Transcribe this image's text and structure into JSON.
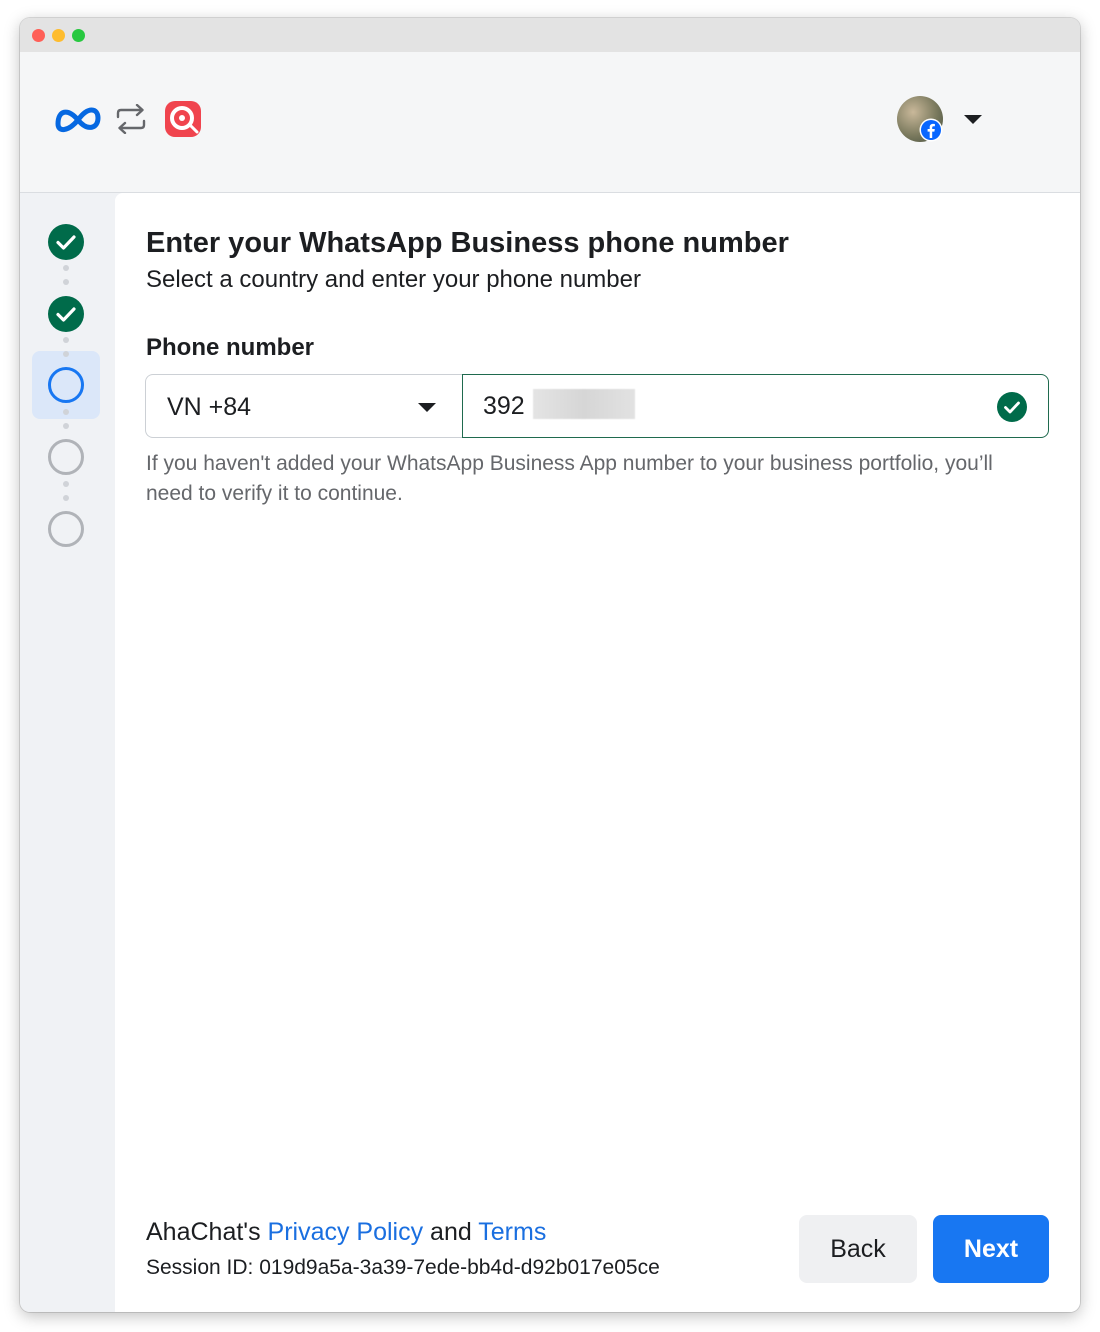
{
  "header": {
    "brand_icon": "meta-logo-icon",
    "connect_icon": "swap-arrows-icon",
    "app_icon": "ahachat-logo-icon",
    "account_badge_icon": "facebook-icon"
  },
  "stepper": {
    "steps": [
      {
        "state": "done"
      },
      {
        "state": "done"
      },
      {
        "state": "current"
      },
      {
        "state": "pending"
      },
      {
        "state": "pending"
      }
    ],
    "colors": {
      "done": "#006b4a",
      "current": "#1877f2",
      "pending": "#b0b3b8"
    }
  },
  "main": {
    "title": "Enter your WhatsApp Business phone number",
    "subtitle": "Select a country and enter your phone number",
    "phone_label": "Phone number",
    "country_value": "VN +84",
    "phone_value": "392",
    "helper_text": "If you haven't added your WhatsApp Business App number to your business portfolio, you’ll need to verify it to continue."
  },
  "footer": {
    "company_prefix": "AhaChat's ",
    "privacy_link": "Privacy Policy",
    "and_text": " and ",
    "terms_link": "Terms",
    "session_label": "Session ID: ",
    "session_id": "019d9a5a-3a39-7ede-bb4d-d92b017e05ce",
    "back_label": "Back",
    "next_label": "Next"
  },
  "colors": {
    "primary": "#1877f2",
    "success": "#006b4a",
    "link": "#1a6fe0"
  }
}
